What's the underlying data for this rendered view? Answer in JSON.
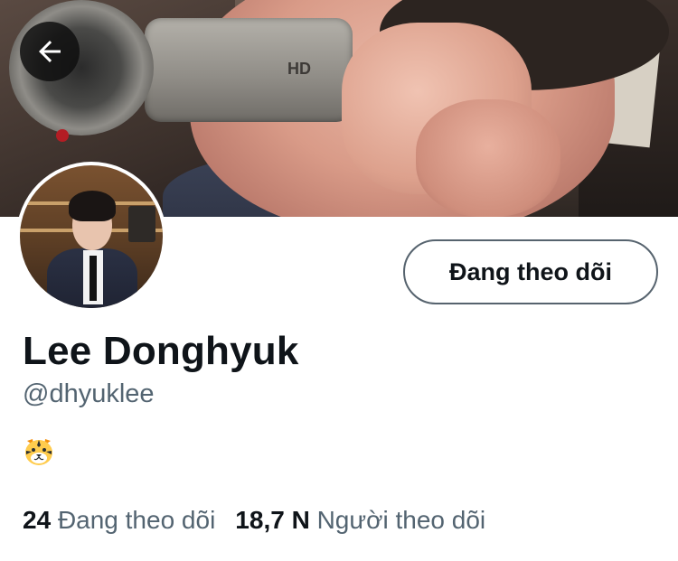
{
  "profile": {
    "display_name": "Lee Donghyuk",
    "handle": "@dhyuklee",
    "bio_emoji_icon": "tiger-face-icon",
    "follow_button_label": "Đang theo dõi",
    "following_count": "24",
    "following_label": "Đang theo dõi",
    "followers_count": "18,7 N",
    "followers_label": "Người theo dõi"
  },
  "banner": {
    "camera_label": "HD"
  },
  "icons": {
    "back": "arrow-left-icon"
  },
  "colors": {
    "text_primary": "#0f1419",
    "text_secondary": "#536471",
    "button_border": "#56636e"
  }
}
